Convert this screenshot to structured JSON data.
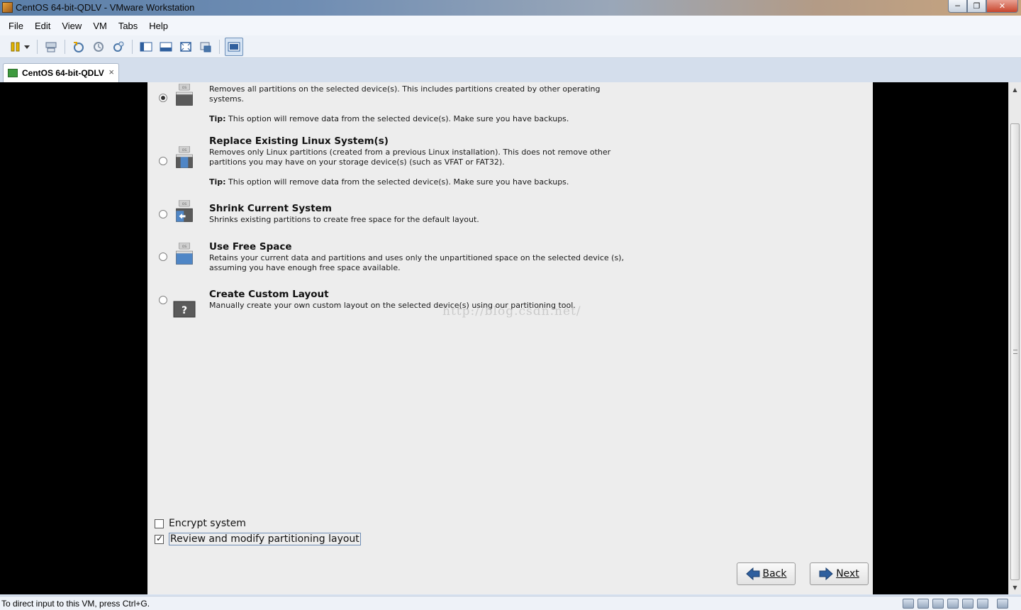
{
  "window": {
    "title": "CentOS 64-bit-QDLV - VMware Workstation",
    "minimize": "─",
    "restore": "❐",
    "close": "✕"
  },
  "menu": [
    "File",
    "Edit",
    "View",
    "VM",
    "Tabs",
    "Help"
  ],
  "toolbar": {
    "icons": [
      "power-icon",
      "dropdown-arrow-icon",
      "network-icon",
      "snapshot-icon",
      "revert-snapshot-icon",
      "snapshot-manager-icon",
      "console-view-icon",
      "quick-switch-icon",
      "full-screen-icon",
      "unity-icon",
      "thumbnail-view-icon"
    ]
  },
  "tab": {
    "label": "CentOS 64-bit-QDLV",
    "close": "×"
  },
  "installer": {
    "options": [
      {
        "title": "",
        "description": "Removes all partitions on the selected device(s).  This includes partitions created by other operating systems.",
        "tip_label": "Tip:",
        "tip": " This option will remove data from the selected device(s).  Make sure you have backups.",
        "icon_text": "OS",
        "selected": true
      },
      {
        "title": "Replace Existing Linux System(s)",
        "description": "Removes only Linux partitions (created from a previous Linux installation).  This does not remove other partitions you may have on your storage device(s) (such as VFAT or FAT32).",
        "tip_label": "Tip:",
        "tip": " This option will remove data from the selected device(s).  Make sure you have backups.",
        "icon_text": "OS",
        "selected": false
      },
      {
        "title": "Shrink Current System",
        "description": "Shrinks existing partitions to create free space for the default layout.",
        "icon_text": "OS",
        "selected": false
      },
      {
        "title": "Use Free Space",
        "description": "Retains your current data and partitions and uses only the unpartitioned space on the selected device (s), assuming you have enough free space available.",
        "icon_text": "OS",
        "selected": false
      },
      {
        "title": "Create Custom Layout",
        "description": "Manually create your own custom layout on the selected device(s) using our partitioning tool.",
        "icon_text": "?",
        "selected": false
      }
    ],
    "watermark": "http://blog.csdn.net/",
    "encrypt": {
      "label": "Encrypt system",
      "checked": false
    },
    "review": {
      "label": "Review and modify partitioning layout",
      "checked": true
    },
    "back_label": "Back",
    "next_label": "Next"
  },
  "status": {
    "text": "To direct input to this VM, press Ctrl+G."
  },
  "colors": {
    "installer_bg": "#ededed",
    "vm_bg": "#000000",
    "arrow_blue": "#2f5f9e"
  }
}
